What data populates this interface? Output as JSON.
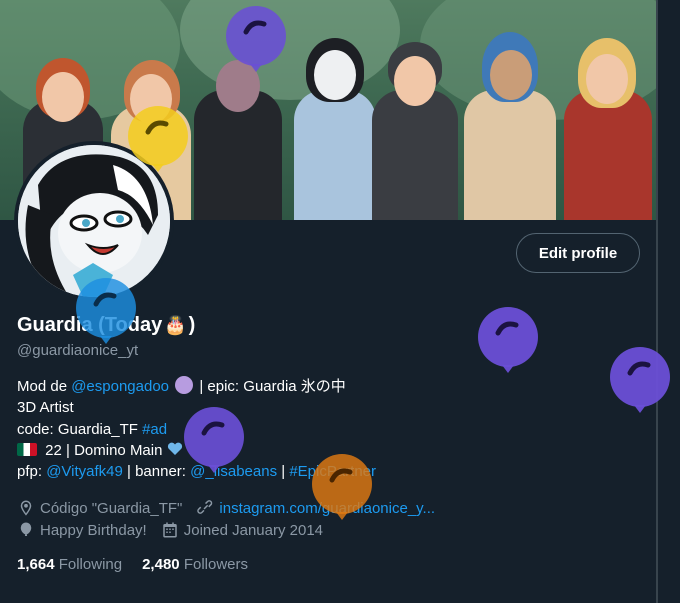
{
  "profile": {
    "name": "Guardia (Today",
    "name_emoji": "🎂",
    "name_close": ")",
    "handle": "@guardiaonice_yt",
    "edit_profile_label": "Edit profile"
  },
  "bio": {
    "line1_prefix": "Mod de ",
    "line1_mention": "@espongadoo",
    "line1_suffix": " | epic: Guardia 氷の中",
    "line2": "3D Artist",
    "line3_prefix": "code: Guardia_TF ",
    "line3_hashtag": "#ad",
    "line4": " 22 | Domino Main",
    "line5_prefix": "pfp: ",
    "line5_mention1": "@Vityafk49",
    "line5_mid": " | banner: ",
    "line5_mention2": "@_lisabeans",
    "line5_sep": " | ",
    "line5_hashtag": "#EpicPartner"
  },
  "meta": {
    "location_icon": "location-pin-icon",
    "location": "Código \"Guardia_TF\"",
    "link_icon": "link-icon",
    "website": "instagram.com/guardiaonice_y...",
    "birthday_icon": "balloon-icon",
    "birthday": "Happy Birthday!",
    "joined_icon": "calendar-icon",
    "joined": "Joined January 2014"
  },
  "counts": {
    "following_count": "1,664",
    "following_label": "Following",
    "followers_count": "2,480",
    "followers_label": "Followers"
  },
  "colors": {
    "background": "#15202b",
    "accent": "#1d9bf0",
    "secondary_text": "#8b98a5",
    "balloon_purple": "#6a4fd6",
    "balloon_blue": "#1d8fe0",
    "balloon_yellow": "#f3cc1d",
    "balloon_orange": "#e07a12"
  }
}
